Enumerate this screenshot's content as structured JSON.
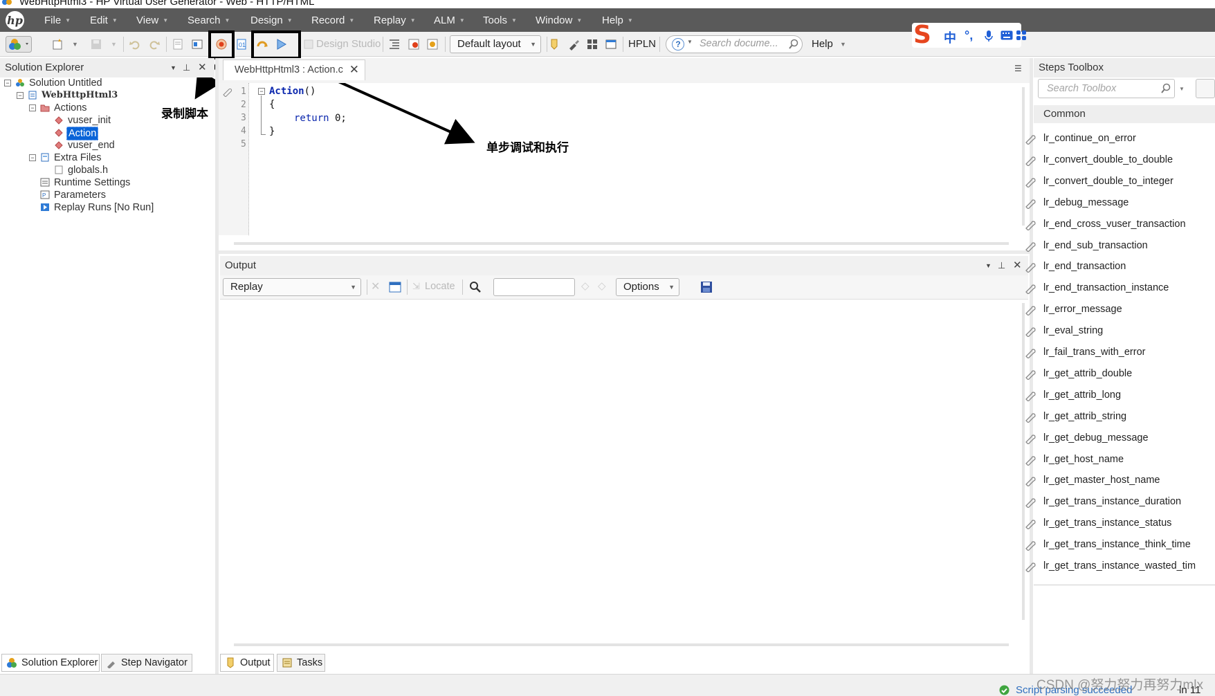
{
  "window": {
    "title": "WebHttpHtml3 - HP Virtual User Generator - Web - HTTP/HTML"
  },
  "menu": [
    {
      "label": "File"
    },
    {
      "label": "Edit"
    },
    {
      "label": "View"
    },
    {
      "label": "Search"
    },
    {
      "label": "Design"
    },
    {
      "label": "Record"
    },
    {
      "label": "Replay"
    },
    {
      "label": "ALM"
    },
    {
      "label": "Tools"
    },
    {
      "label": "Window"
    },
    {
      "label": "Help"
    }
  ],
  "toolbar": {
    "design_studio": "Design Studio",
    "layout": "Default layout",
    "hpln": "HPLN",
    "search_placeholder": "Search docume...",
    "help": "Help"
  },
  "ime": {
    "chinese": "中",
    "punct": "°,"
  },
  "annotations": {
    "record": "录制脚本",
    "step": "单步调试和执行"
  },
  "solution_explorer": {
    "title": "Solution Explorer",
    "tree": {
      "solution": "Solution Untitled",
      "script": "WebHttpHtml3",
      "actions": "Actions",
      "vuser_init": "vuser_init",
      "action": "Action",
      "vuser_end": "vuser_end",
      "extra_files": "Extra Files",
      "globals": "globals.h",
      "runtime": "Runtime Settings",
      "parameters": "Parameters",
      "replay_runs": "Replay Runs [No Run]"
    }
  },
  "editor": {
    "tab": "WebHttpHtml3 : Action.c",
    "line_numbers": [
      "1",
      "2",
      "3",
      "4",
      "5"
    ],
    "code": {
      "l1_name": "Action",
      "l1_rest": "()",
      "l2": "{",
      "l3_kw": "return",
      "l3_rest": " 0;",
      "l4": "}"
    }
  },
  "output": {
    "title": "Output",
    "source": "Replay",
    "locate": "Locate",
    "options": "Options"
  },
  "steps_toolbox": {
    "title": "Steps Toolbox",
    "search_placeholder": "Search Toolbox",
    "category": "Common",
    "items": [
      "lr_continue_on_error",
      "lr_convert_double_to_double",
      "lr_convert_double_to_integer",
      "lr_debug_message",
      "lr_end_cross_vuser_transaction",
      "lr_end_sub_transaction",
      "lr_end_transaction",
      "lr_end_transaction_instance",
      "lr_error_message",
      "lr_eval_string",
      "lr_fail_trans_with_error",
      "lr_get_attrib_double",
      "lr_get_attrib_long",
      "lr_get_attrib_string",
      "lr_get_debug_message",
      "lr_get_host_name",
      "lr_get_master_host_name",
      "lr_get_trans_instance_duration",
      "lr_get_trans_instance_status",
      "lr_get_trans_instance_think_time",
      "lr_get_trans_instance_wasted_tim"
    ]
  },
  "bottom_tabs": {
    "solution_explorer": "Solution Explorer",
    "step_navigator": "Step Navigator",
    "output": "Output",
    "tasks": "Tasks"
  },
  "status": {
    "message": "Script parsing succeeded",
    "watermark": "CSDN @努力努力再努力mlx",
    "line": "ln 11"
  }
}
